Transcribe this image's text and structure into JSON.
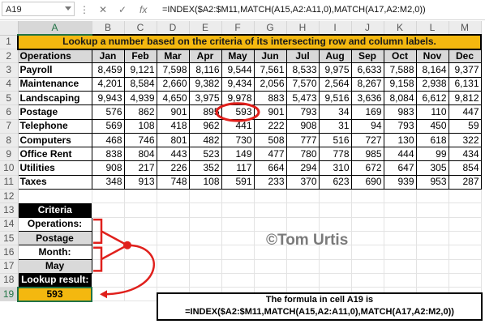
{
  "formula_bar": {
    "name_box": "A19",
    "cancel_icon": "cancel-icon",
    "enter_icon": "check-icon",
    "fx_label": "fx",
    "formula": "=INDEX($A2:$M11,MATCH(A15,A2:A11,0),MATCH(A17,A2:M2,0))"
  },
  "sheet": {
    "columns": [
      "A",
      "B",
      "C",
      "D",
      "E",
      "F",
      "G",
      "H",
      "I",
      "J",
      "K",
      "L",
      "M"
    ],
    "rows": [
      "1",
      "2",
      "3",
      "4",
      "5",
      "6",
      "7",
      "8",
      "9",
      "10",
      "11",
      "12",
      "13",
      "14",
      "15",
      "16",
      "17",
      "18",
      "19"
    ],
    "selected_cell": "A19",
    "title": "Lookup a number based on the criteria of its intersecting row and column labels.",
    "header_row": [
      "Operations",
      "Jan",
      "Feb",
      "Mar",
      "Apr",
      "May",
      "Jun",
      "Jul",
      "Aug",
      "Sep",
      "Oct",
      "Nov",
      "Dec"
    ],
    "data_rows": [
      [
        "Payroll",
        "8,459",
        "9,121",
        "7,598",
        "8,116",
        "9,544",
        "7,561",
        "8,533",
        "9,975",
        "6,633",
        "7,588",
        "8,164",
        "9,377"
      ],
      [
        "Maintenance",
        "4,201",
        "8,584",
        "2,660",
        "9,382",
        "9,434",
        "2,056",
        "7,570",
        "2,564",
        "8,267",
        "9,158",
        "2,938",
        "6,131"
      ],
      [
        "Landscaping",
        "9,943",
        "4,939",
        "4,650",
        "3,975",
        "9,978",
        "883",
        "5,473",
        "9,516",
        "3,636",
        "8,084",
        "6,612",
        "9,812"
      ],
      [
        "Postage",
        "576",
        "862",
        "901",
        "895",
        "593",
        "901",
        "793",
        "34",
        "169",
        "983",
        "110",
        "447"
      ],
      [
        "Telephone",
        "569",
        "108",
        "418",
        "962",
        "441",
        "222",
        "908",
        "31",
        "94",
        "793",
        "450",
        "59"
      ],
      [
        "Computers",
        "468",
        "746",
        "801",
        "482",
        "730",
        "508",
        "777",
        "516",
        "727",
        "130",
        "618",
        "322"
      ],
      [
        "Office Rent",
        "838",
        "804",
        "443",
        "523",
        "149",
        "477",
        "780",
        "778",
        "985",
        "444",
        "99",
        "434"
      ],
      [
        "Utilities",
        "908",
        "217",
        "226",
        "352",
        "117",
        "664",
        "294",
        "310",
        "672",
        "647",
        "305",
        "854"
      ],
      [
        "Taxes",
        "348",
        "913",
        "748",
        "108",
        "591",
        "233",
        "370",
        "623",
        "690",
        "939",
        "953",
        "287"
      ]
    ],
    "criteria": {
      "heading": "Criteria",
      "operations_label": "Operations:",
      "operations_value": "Postage",
      "month_label": "Month:",
      "month_value": "May",
      "result_label": "Lookup result:",
      "result_value": "593"
    },
    "highlight_value": "593"
  },
  "watermark": "©Tom Urtis",
  "formula_note": {
    "line1": "The formula in cell A19 is",
    "line2": "=INDEX($A2:$M11,MATCH(A15,A2:A11,0),MATCH(A17,A2:M2,0))"
  },
  "colors": {
    "title_fill": "#f4b80f",
    "header_fill": "#d9d9d9",
    "criteria_fill": "#000000",
    "result_fill": "#f4b80f",
    "annotation_red": "#e0201c",
    "selection_green": "#217346"
  }
}
